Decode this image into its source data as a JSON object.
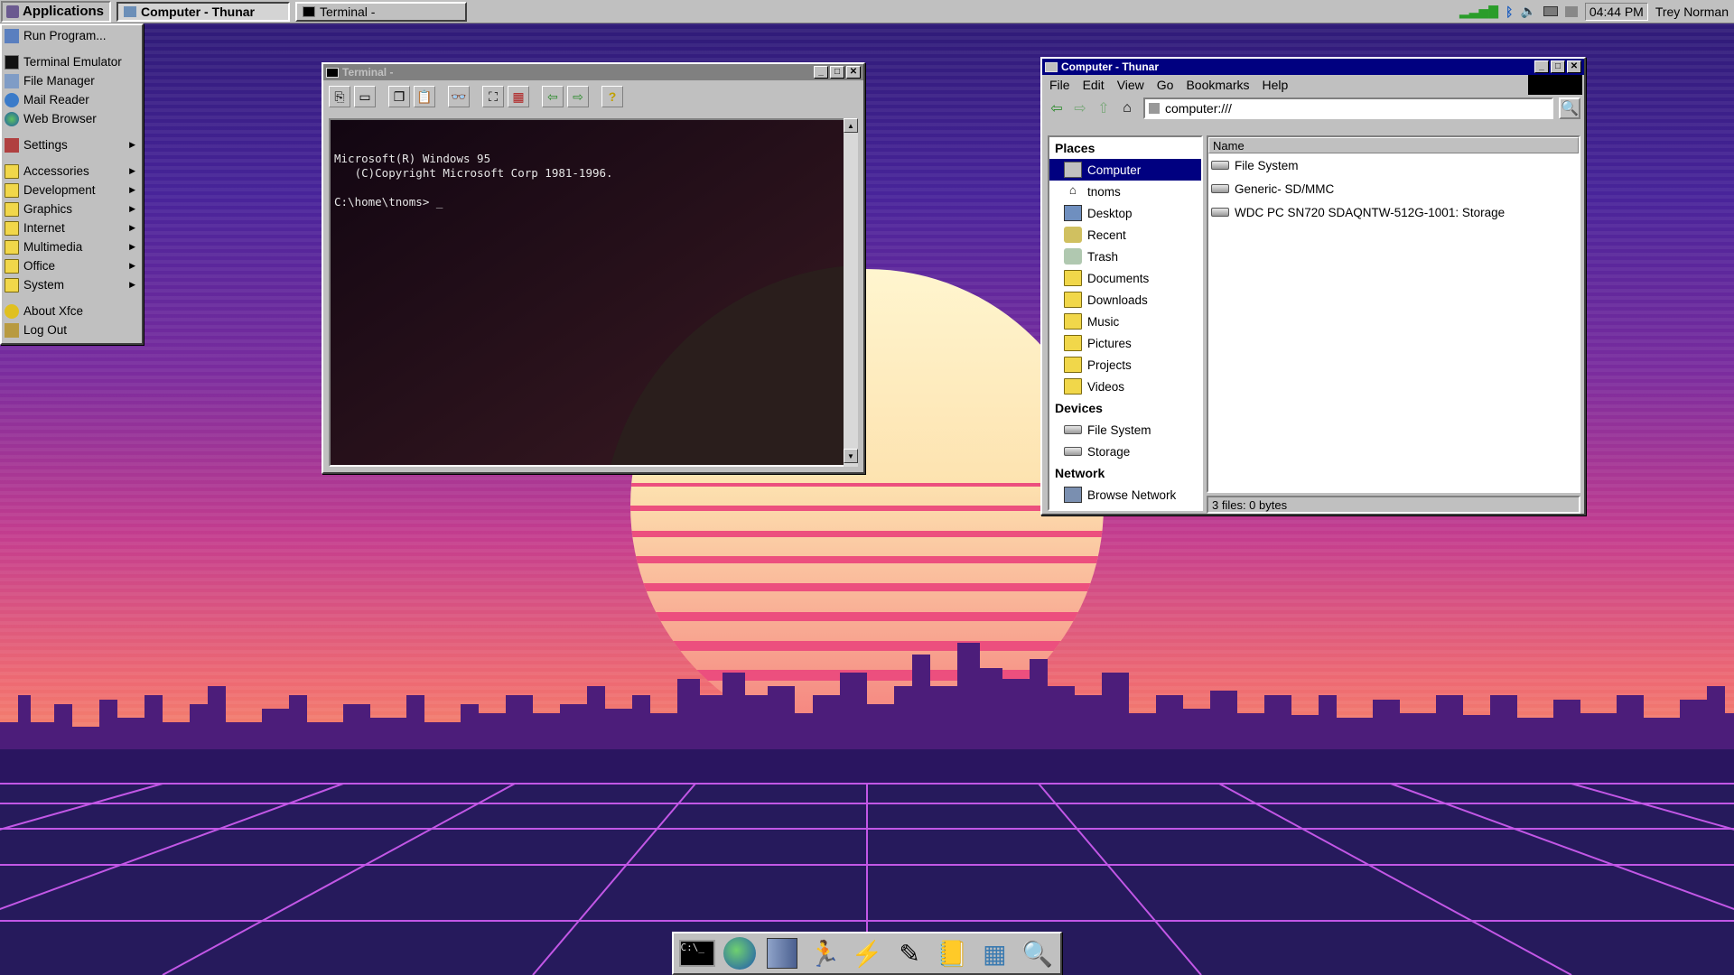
{
  "panel": {
    "applications_label": "Applications",
    "tasks": [
      {
        "label": "Computer - Thunar",
        "active": true
      },
      {
        "label": "Terminal -",
        "active": false
      }
    ],
    "clock": "04:44 PM",
    "user": "Trey Norman"
  },
  "app_menu": {
    "items": [
      {
        "label": "Run Program...",
        "icon": "run-icon"
      },
      {
        "label": "Terminal Emulator",
        "icon": "terminal-icon"
      },
      {
        "label": "File Manager",
        "icon": "file-manager-icon"
      },
      {
        "label": "Mail Reader",
        "icon": "mail-icon"
      },
      {
        "label": "Web Browser",
        "icon": "globe-icon"
      },
      {
        "label": "Settings",
        "icon": "settings-icon",
        "submenu": true
      },
      {
        "label": "Accessories",
        "icon": "folder-icon",
        "submenu": true
      },
      {
        "label": "Development",
        "icon": "folder-icon",
        "submenu": true
      },
      {
        "label": "Graphics",
        "icon": "folder-icon",
        "submenu": true
      },
      {
        "label": "Internet",
        "icon": "folder-icon",
        "submenu": true
      },
      {
        "label": "Multimedia",
        "icon": "folder-icon",
        "submenu": true
      },
      {
        "label": "Office",
        "icon": "folder-icon",
        "submenu": true
      },
      {
        "label": "System",
        "icon": "folder-icon",
        "submenu": true
      },
      {
        "label": "About Xfce",
        "icon": "about-icon"
      },
      {
        "label": "Log Out",
        "icon": "logout-icon"
      }
    ]
  },
  "terminal": {
    "title": "Terminal -",
    "lines": "Microsoft(R) Windows 95\n   (C)Copyright Microsoft Corp 1981-1996.\n\nC:\\home\\tnoms> _"
  },
  "thunar": {
    "title": "Computer - Thunar",
    "menu": [
      "File",
      "Edit",
      "View",
      "Go",
      "Bookmarks",
      "Help"
    ],
    "address": "computer:///",
    "places_header": "Places",
    "places": [
      "Computer",
      "tnoms",
      "Desktop",
      "Recent",
      "Trash",
      "Documents",
      "Downloads",
      "Music",
      "Pictures",
      "Projects",
      "Videos"
    ],
    "devices_header": "Devices",
    "devices": [
      "File System",
      "Storage"
    ],
    "network_header": "Network",
    "network": [
      "Browse Network"
    ],
    "column_name": "Name",
    "files": [
      "File System",
      "Generic- SD/MMC",
      "WDC PC SN720 SDAQNTW-512G-1001: Storage"
    ],
    "status": "3 files: 0 bytes"
  },
  "dock": [
    "terminal-icon",
    "web-browser-icon",
    "file-manager-icon",
    "runner-icon",
    "bolt-icon",
    "draw-icon",
    "notebook-icon",
    "network-icon",
    "search-icon"
  ]
}
